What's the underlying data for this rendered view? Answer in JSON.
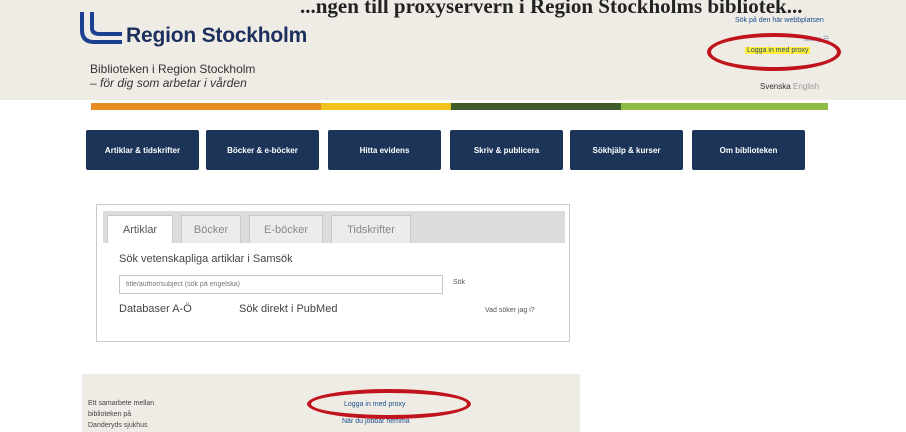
{
  "top_title": "...ngen till proxyservern i Region Stockholms bibliotek...",
  "header": {
    "logo_text": "Region Stockholm",
    "tagline_1": "Biblioteken i Region Stockholm",
    "tagline_2": "– för dig som arbetar i vården"
  },
  "utility": {
    "search_site": "Sök på den här webbplatsen",
    "menu": "Meny ☰",
    "login_proxy": "Logga in med proxy",
    "lang_sv": "Svenska",
    "lang_en": "English"
  },
  "nav": [
    {
      "label": "Artiklar & tidskrifter"
    },
    {
      "label": "Böcker & e-böcker"
    },
    {
      "label": "Hitta evidens"
    },
    {
      "label": "Skriv & publicera"
    },
    {
      "label": "Sökhjälp & kurser"
    },
    {
      "label": "Om biblioteken"
    }
  ],
  "search_widget": {
    "tabs": [
      {
        "label": "Artiklar",
        "active": true
      },
      {
        "label": "Böcker",
        "active": false
      },
      {
        "label": "E-böcker",
        "active": false
      },
      {
        "label": "Tidskrifter",
        "active": false
      }
    ],
    "heading": "Sök vetenskapliga artiklar i Samsök",
    "placeholder": "title/author/subject (sök på engelska)",
    "search_button": "Sök",
    "databases_link": "Databaser A-Ö",
    "pubmed_link": "Sök direkt i PubMed",
    "help_link": "Vad söker jag i?"
  },
  "footer": {
    "collab_1": "Ett samarbete mellan",
    "collab_2": "biblioteken på",
    "collab_3": "Danderyds sjukhus",
    "login_proxy": "Logga in med proxy",
    "when_home": "När du jobbar hemma"
  },
  "colors": {
    "brand_navy": "#1c3458",
    "header_bg": "#efece6",
    "highlight": "#ffef39",
    "annotation_red": "#c0131b",
    "bar_orange": "#e98c24",
    "bar_yellow": "#f2c21d",
    "bar_dark_green": "#3e5d2a",
    "bar_light_green": "#8cbc44"
  }
}
